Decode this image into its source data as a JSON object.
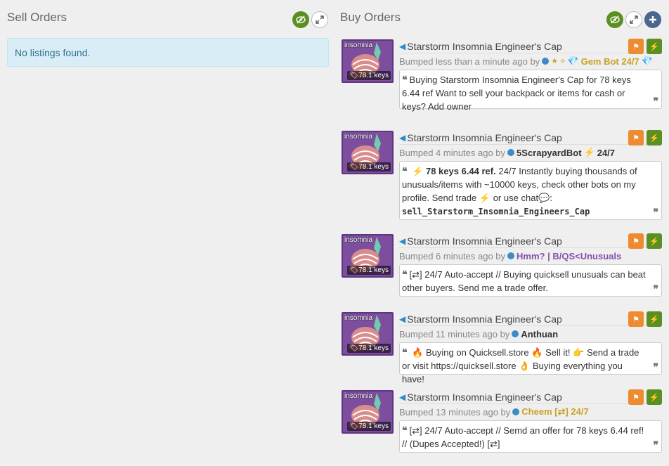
{
  "sell": {
    "title": "Sell Orders",
    "empty": "No listings found."
  },
  "buy": {
    "title": "Buy Orders",
    "listings": [
      {
        "title": "Starstorm Insomnia Engineer's Cap",
        "effect": "insomnia",
        "price": "78.1 keys",
        "bumped": "Bumped less than a minute ago by",
        "user_prefix": "★ ⟡",
        "user": "Gem Bot 24/7",
        "user_color": "#c9a227",
        "message": "Buying Starstorm Insomnia Engineer's Cap for 78 keys 6.44 ref Want to sell your backpack or items for cash or keys? Add owner"
      },
      {
        "title": "Starstorm Insomnia Engineer's Cap",
        "effect": "insomnia",
        "price": "78.1 keys",
        "bumped": "Bumped 4 minutes ago by",
        "user": "5ScrapyardBot",
        "user_suffix": "24/7",
        "user_color": "#333333",
        "msg_bold": "78 keys 6.44 ref.",
        "message": "24/7 Instantly buying thousands of unusuals/items with ~10000 keys, check other bots on my profile. Send",
        "msg_trade": "trade",
        "msg_or": "or",
        "msg_use": "use",
        "msg_chat": "chat",
        "msg_code": "sell_Starstorm_Insomnia_Engineers_Cap"
      },
      {
        "title": "Starstorm Insomnia Engineer's Cap",
        "effect": "insomnia",
        "price": "78.1 keys",
        "bumped": "Bumped 6 minutes ago by",
        "user": "Hmm? | B/QS<Unusuals",
        "user_color": "#8650ac",
        "message": "[⇄] 24/7 Auto-accept // Buying quicksell unusuals can beat other buyers. Send me a trade offer."
      },
      {
        "title": "Starstorm Insomnia Engineer's Cap",
        "effect": "insomnia",
        "price": "78.1 keys",
        "bumped": "Bumped 11 minutes ago by",
        "user": "Anthuan",
        "user_color": "#333333",
        "msg_a": "Buying on Quicksell.store",
        "msg_b": "Sell it!",
        "msg_c": "Send a trade or visit https://quicksell.store",
        "msg_d": "Buying everything you have!"
      },
      {
        "title": "Starstorm Insomnia Engineer's Cap",
        "effect": "insomnia",
        "price": "78.1 keys",
        "bumped": "Bumped 13 minutes ago by",
        "user": "Cheem [⇄] 24/7",
        "user_color": "#c9a227",
        "message": "[⇄] 24/7 Auto-accept // Semd an offer for 78 keys 6.44 ref! // (Dupes Accepted!) [⇄]"
      }
    ]
  },
  "icons": {
    "eye": "eye-slash-icon",
    "expand": "expand-icon",
    "add": "plus-icon",
    "flag": "flag-icon",
    "bolt": "lightning-icon",
    "tag": "tag-icon",
    "arrow": "arrow-left-icon"
  },
  "colors": {
    "green": "#5b8f22",
    "orange": "#ee8a2f",
    "blue": "#4a6790",
    "item_bg": "#7d4e9e"
  }
}
